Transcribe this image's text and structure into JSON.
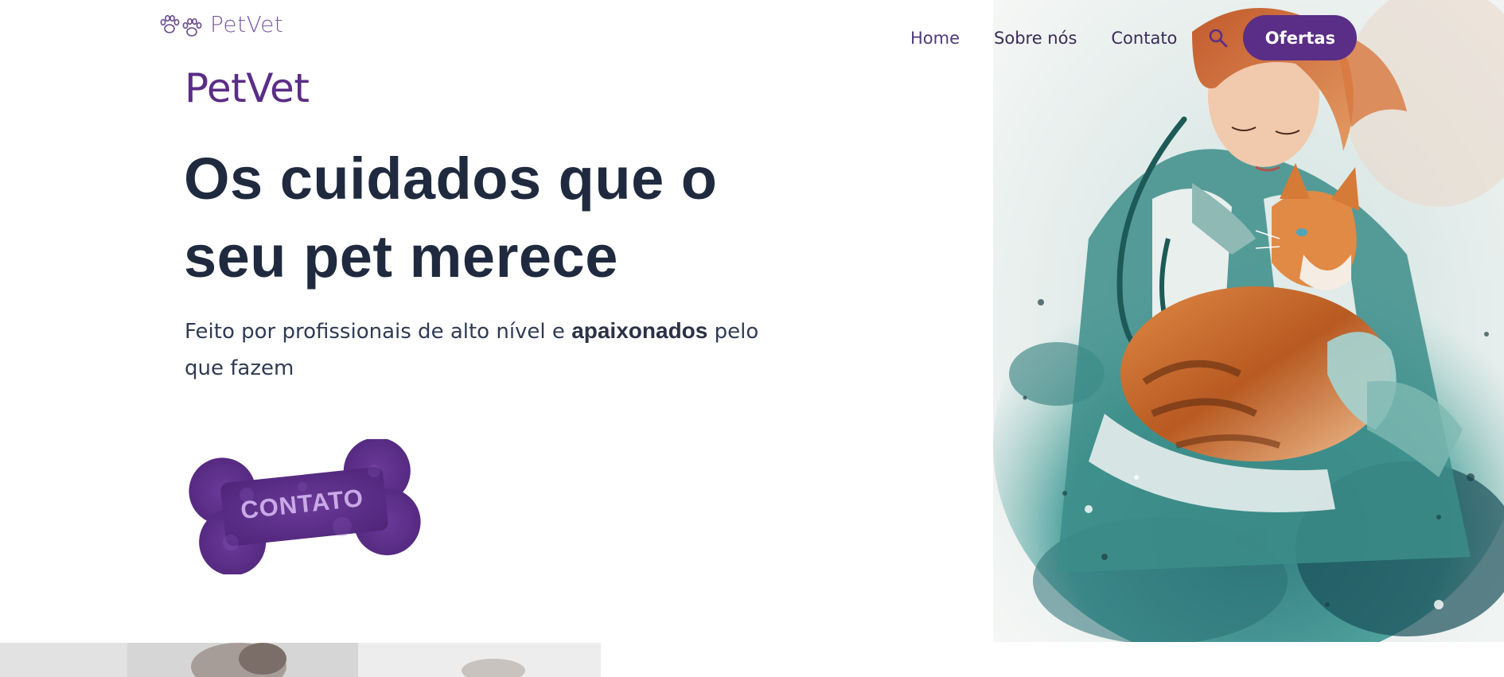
{
  "header": {
    "logo_text": "PetVet",
    "nav": [
      {
        "label": "Home"
      },
      {
        "label": "Sobre nós"
      },
      {
        "label": "Contato"
      }
    ],
    "offer_button": "Ofertas"
  },
  "hero": {
    "brand": "PetVet",
    "title_line1": "Os cuidados que o",
    "title_line2": "seu pet merece",
    "subtitle_before": "Feito por profissionais de alto nível e ",
    "subtitle_bold": "apaixonados",
    "subtitle_after": " pelo que fazem",
    "cta_label": "CONTATO"
  },
  "colors": {
    "brand_purple": "#5a2d86",
    "heading": "#1f2a3f",
    "body_text": "#2f3b52",
    "teal": "#2f7f7c",
    "orange": "#d5743a"
  },
  "icons": {
    "logo": "paw-icon",
    "search": "search-icon"
  }
}
